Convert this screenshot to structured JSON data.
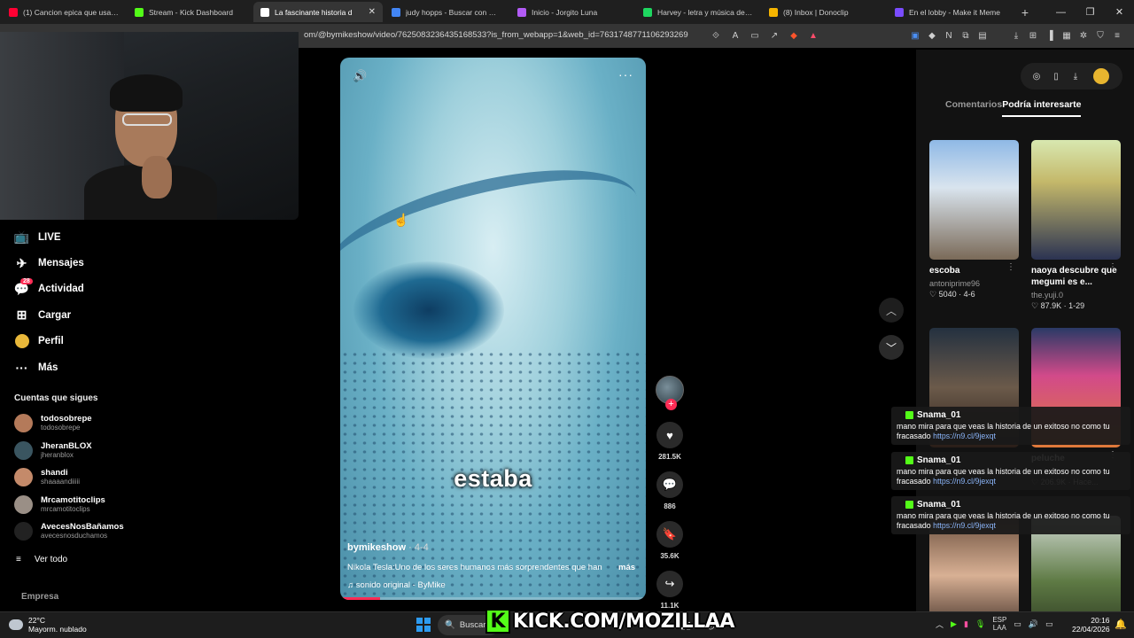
{
  "browser": {
    "tabs": [
      {
        "title": "(1) Cancion epica que usa The",
        "color": "#ff0033"
      },
      {
        "title": "Stream - Kick Dashboard",
        "color": "#53fc18"
      },
      {
        "title": "La fascinante historia d",
        "color": "#ffffff",
        "active": true
      },
      {
        "title": "judy hopps - Buscar con Goog",
        "color": "#4285f4"
      },
      {
        "title": "Inicio - Jorgito Luna",
        "color": "#b25bf5"
      },
      {
        "title": "Harvey - letra y música de Her",
        "color": "#1ed760"
      },
      {
        "title": "(8) Inbox | Donoclip",
        "color": "#f5b400"
      },
      {
        "title": "En el lobby - Make it Meme",
        "color": "#7a4cff"
      }
    ],
    "close_tab_glyph": "✕",
    "new_tab_glyph": "+",
    "url": "om/@bymikeshow/video/7625083236435168533?is_from_webapp=1&web_id=7631748771106293269"
  },
  "sidebar": {
    "items": [
      {
        "label": "LIVE",
        "icon": "live-icon",
        "glyph": "📺"
      },
      {
        "label": "Mensajes",
        "icon": "messages-icon",
        "glyph": "✈"
      },
      {
        "label": "Actividad",
        "icon": "activity-icon",
        "glyph": "💬",
        "badge": "28"
      },
      {
        "label": "Cargar",
        "icon": "upload-icon",
        "glyph": "⊞"
      },
      {
        "label": "Perfil",
        "icon": "profile-icon",
        "glyph": ""
      },
      {
        "label": "Más",
        "icon": "more-icon",
        "glyph": "···"
      }
    ],
    "following_title": "Cuentas que sigues",
    "following": [
      {
        "name": "todosobrepe",
        "handle": "todosobrepe",
        "color": "#b47a5a"
      },
      {
        "name": "JheranBLOX",
        "handle": "jheranblox",
        "color": "#3a5560"
      },
      {
        "name": "shandi",
        "handle": "shaaaandiiiii",
        "color": "#c48a6a"
      },
      {
        "name": "Mrcamotitoclips",
        "handle": "mrcamotitoclips",
        "color": "#9a8f86"
      },
      {
        "name": "AvecesNosBañamos",
        "handle": "avecesnosduchamos",
        "color": "#222222"
      }
    ],
    "see_all_glyph": "≡",
    "see_all": "Ver todo",
    "company": "Empresa"
  },
  "video": {
    "caption_word": "estaba",
    "author": "bymikeshow",
    "date": "· 4-4",
    "description": "Nikola Tesla:Uno de los seres humanos más sorprendentes que han",
    "more_label": "más",
    "music": "sonido original - ByMike",
    "progress": 0.13,
    "volume_glyph": "🔊",
    "options_glyph": "···"
  },
  "actions": [
    {
      "name": "like",
      "glyph": "♥",
      "count": "281.5K"
    },
    {
      "name": "comment",
      "glyph": "💬",
      "count": "886"
    },
    {
      "name": "save",
      "glyph": "🔖",
      "count": "35.6K"
    },
    {
      "name": "share",
      "glyph": "↪",
      "count": "11.1K"
    }
  ],
  "follow_plus": "+",
  "nav_up": "︿",
  "nav_down": "﹀",
  "right_panel": {
    "tab_comments": "Comentarios",
    "tab_interest": "Podría interesarte",
    "cards": [
      {
        "title": "escoba",
        "user": "antoniprime96",
        "meta": "♡ 5040 · 4-6",
        "bg": "linear-gradient(180deg,#8fb9e6 0%,#d9e4ee 40%,#7a6a58 100%)"
      },
      {
        "title": "naoya descubre que megumi es e...",
        "user": "the.yuji.0",
        "meta": "♡ 87.9K · 1-29",
        "bg": "linear-gradient(180deg,#d8e8b0 0%,#c4b86a 35%,#2b3352 100%)"
      },
      {
        "title": "",
        "user": "",
        "meta": "",
        "bg": "linear-gradient(180deg,#243140 0%,#6b5a4a 50%,#2a1e18 100%)"
      },
      {
        "title": "peluche",
        "user": "buckcvs",
        "meta": "♡ 206.9K · Hace...",
        "bg": "linear-gradient(180deg,#2a3a66 0%,#d24a8a 40%,#e07a3a 100%)"
      },
      {
        "title": "",
        "user": "",
        "meta": "",
        "bg": "linear-gradient(180deg,#6b4f3d 0%,#d8b094 50%,#3a2a22 100%)"
      },
      {
        "title": "",
        "user": "",
        "meta": "",
        "bg": "linear-gradient(180deg,#cfd8d0 0%,#5e7a44 55%,#2d3a22 100%)"
      }
    ]
  },
  "chat": [
    {
      "user": "Snama_01",
      "text": "mano mira para que veas la historia de un exitoso no como tu fracasado",
      "link": "https://n9.cl/9jexqt"
    },
    {
      "user": "Snama_01",
      "text": "mano mira para que veas la historia de un exitoso no como tu fracasado",
      "link": "https://n9.cl/9jexqt"
    },
    {
      "user": "Snama_01",
      "text": "mano mira para que veas la historia de un exitoso no como tu fracasado",
      "link": "https://n9.cl/9jexqt"
    }
  ],
  "taskbar": {
    "temp": "22°C",
    "weather": "Mayorm. nublado",
    "search": "Buscar",
    "search_glyph": "🔍",
    "kick_logo_letter": "K",
    "kick_text": "KICK.COM/MOZILLAA",
    "lang_top": "ESP",
    "lang_bottom": "LAA",
    "time": "20:16",
    "date": "22/04/2026"
  }
}
